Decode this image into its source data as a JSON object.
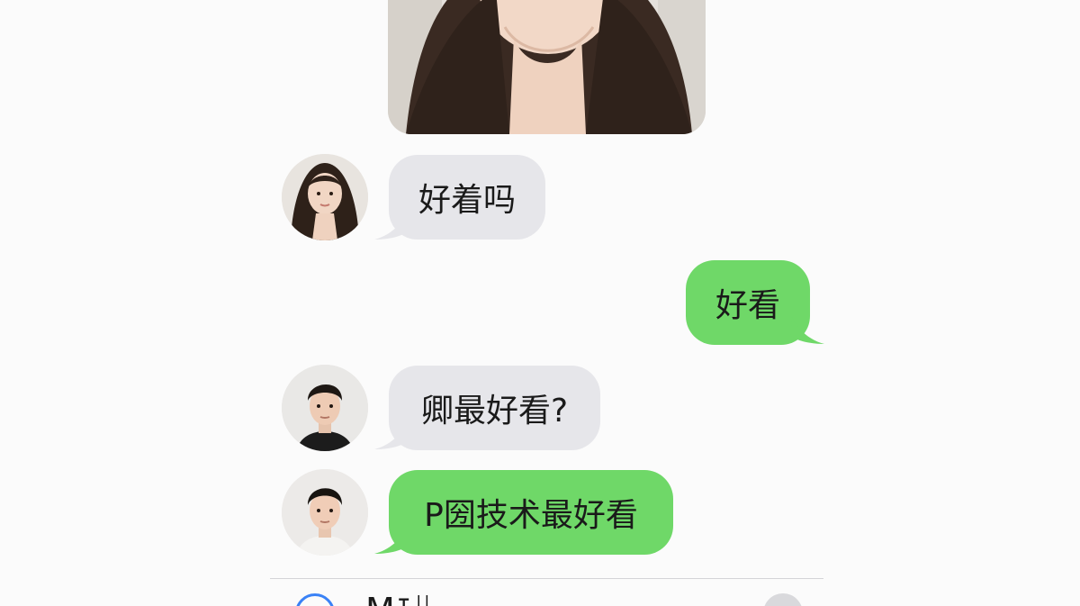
{
  "conversation": {
    "messages": [
      {
        "sender": "girl",
        "type": "photo",
        "side": "incoming"
      },
      {
        "sender": "girl",
        "type": "text",
        "side": "incoming",
        "text": "好着吗"
      },
      {
        "sender": "me",
        "type": "text",
        "side": "outgoing",
        "text": "好看"
      },
      {
        "sender": "boy1",
        "type": "text",
        "side": "incoming",
        "text": "卿最好看?"
      },
      {
        "sender": "boy2",
        "type": "text",
        "side": "incoming",
        "text": "P圀技术最好看"
      }
    ]
  },
  "composer": {
    "placeholder": "Ɱ⊺ᚺ",
    "icons": {
      "left": "plus-circle-icon",
      "right": "mic-icon"
    }
  },
  "colors": {
    "incoming_bubble": "#e6e6ea",
    "outgoing_bubble": "#6fd868",
    "accent": "#3a82f6"
  }
}
